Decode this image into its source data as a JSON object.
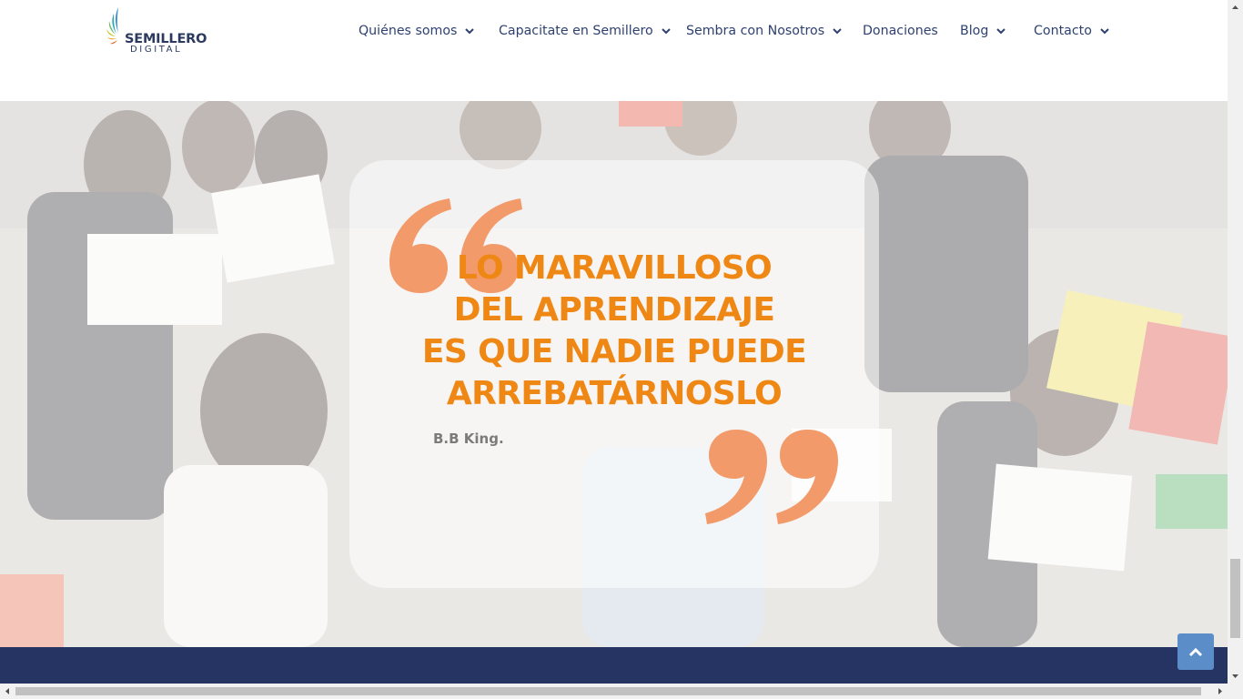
{
  "logo": {
    "line1": "SEMILLERO",
    "line2": "DIGITAL"
  },
  "nav": [
    {
      "label": "Quiénes somos",
      "dropdown": true
    },
    {
      "label": "Capacitate en Semillero",
      "dropdown": true
    },
    {
      "label": "Sembra con Nosotros",
      "dropdown": true
    },
    {
      "label": "Donaciones",
      "dropdown": false
    },
    {
      "label": "Blog",
      "dropdown": true
    },
    {
      "label": "Contacto",
      "dropdown": true
    }
  ],
  "quote": {
    "lines": [
      "LO MARAVILLOSO",
      "DEL APRENDIZAJE",
      "ES QUE NADIE PUEDE",
      "ARREBATÁRNOSLO"
    ],
    "author": "B.B King."
  },
  "colors": {
    "nav_text": "#2e4170",
    "quote_orange": "#ef8715",
    "quote_mark": "#f39a6a",
    "footer_navy": "#253462",
    "to_top": "#5b8ec8"
  },
  "icons": {
    "scroll_to_top": "chevron-up-icon",
    "nav_dropdown": "chevron-down-icon"
  }
}
